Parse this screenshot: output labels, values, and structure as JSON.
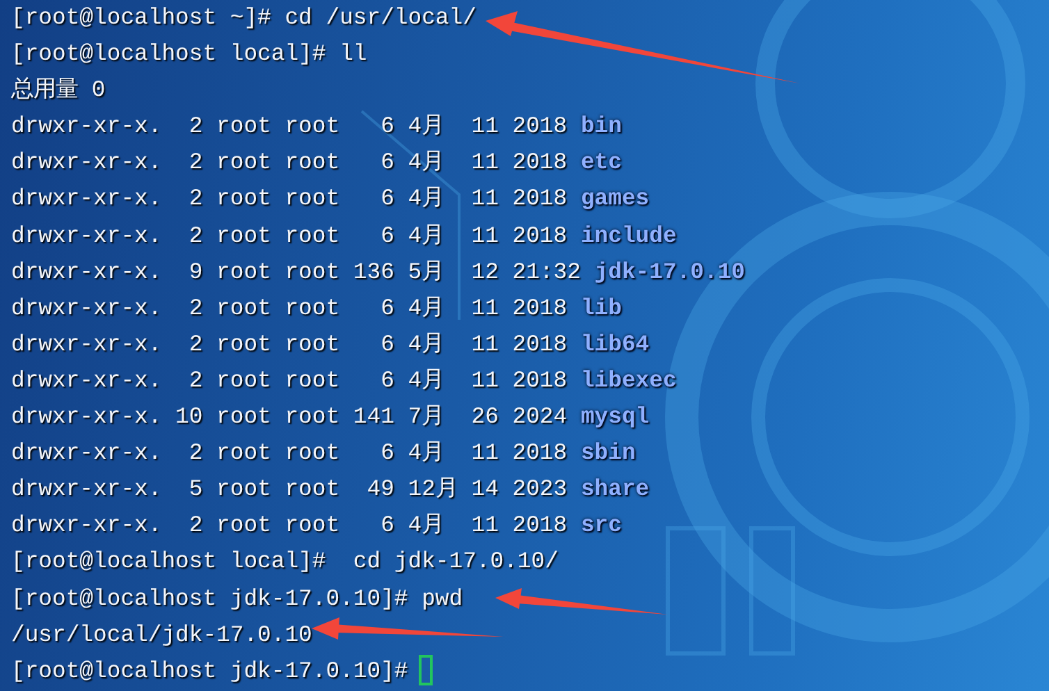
{
  "terminal": {
    "lines": [
      {
        "kind": "text",
        "text": "[root@localhost ~]# cd /usr/local/"
      },
      {
        "kind": "text",
        "text": "[root@localhost local]# ll"
      },
      {
        "kind": "text",
        "text": "总用量 0"
      },
      {
        "kind": "entry",
        "info": "drwxr-xr-x.  2 root root   6 4月  11 2018",
        "name": "bin"
      },
      {
        "kind": "entry",
        "info": "drwxr-xr-x.  2 root root   6 4月  11 2018",
        "name": "etc"
      },
      {
        "kind": "entry",
        "info": "drwxr-xr-x.  2 root root   6 4月  11 2018",
        "name": "games"
      },
      {
        "kind": "entry",
        "info": "drwxr-xr-x.  2 root root   6 4月  11 2018",
        "name": "include"
      },
      {
        "kind": "entry",
        "info": "drwxr-xr-x.  9 root root 136 5月  12 21:32",
        "name": "jdk-17.0.10"
      },
      {
        "kind": "entry",
        "info": "drwxr-xr-x.  2 root root   6 4月  11 2018",
        "name": "lib"
      },
      {
        "kind": "entry",
        "info": "drwxr-xr-x.  2 root root   6 4月  11 2018",
        "name": "lib64"
      },
      {
        "kind": "entry",
        "info": "drwxr-xr-x.  2 root root   6 4月  11 2018",
        "name": "libexec"
      },
      {
        "kind": "entry",
        "info": "drwxr-xr-x. 10 root root 141 7月  26 2024",
        "name": "mysql"
      },
      {
        "kind": "entry",
        "info": "drwxr-xr-x.  2 root root   6 4月  11 2018",
        "name": "sbin"
      },
      {
        "kind": "entry",
        "info": "drwxr-xr-x.  5 root root  49 12月 14 2023",
        "name": "share"
      },
      {
        "kind": "entry",
        "info": "drwxr-xr-x.  2 root root   6 4月  11 2018",
        "name": "src"
      },
      {
        "kind": "text",
        "text": "[root@localhost local]#  cd jdk-17.0.10/"
      },
      {
        "kind": "text",
        "text": "[root@localhost jdk-17.0.10]# pwd"
      },
      {
        "kind": "text",
        "text": "/usr/local/jdk-17.0.10"
      },
      {
        "kind": "prompt",
        "text": "[root@localhost jdk-17.0.10]#"
      }
    ]
  }
}
